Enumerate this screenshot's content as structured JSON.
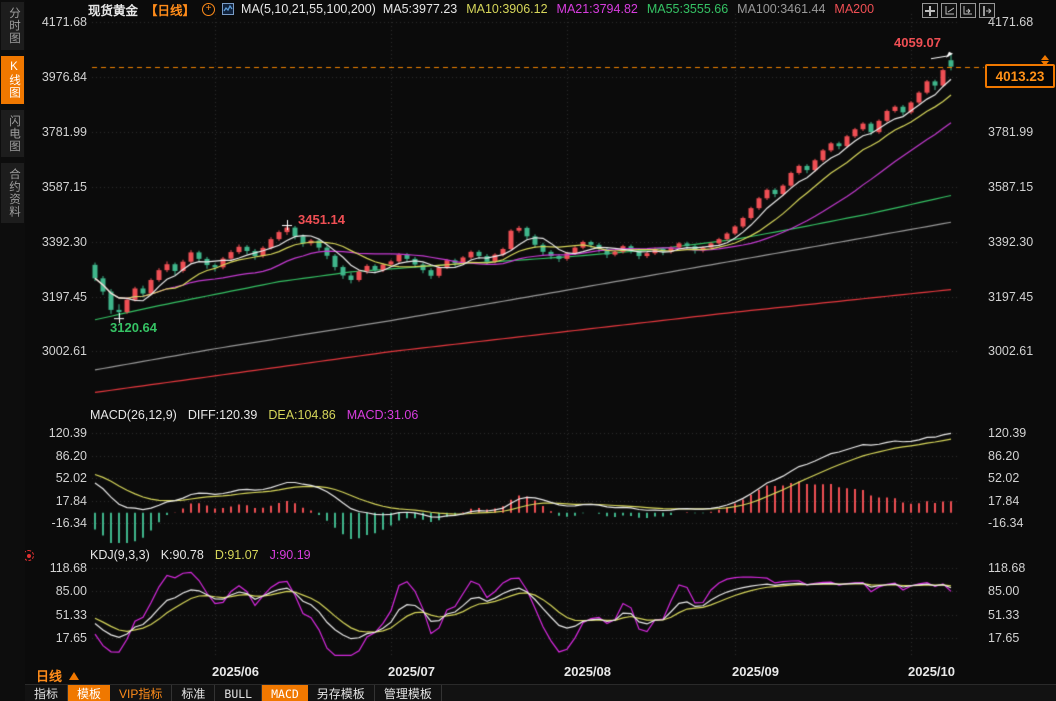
{
  "header": {
    "title": "现货黄金",
    "period": "【日线】",
    "ma_settings": "MA(5,10,21,55,100,200)",
    "ma_values": [
      {
        "label": "MA5:3977.23",
        "color": "#e6e6e6"
      },
      {
        "label": "MA10:3906.12",
        "color": "#d6d65a"
      },
      {
        "label": "MA21:3794.82",
        "color": "#d83ddf"
      },
      {
        "label": "MA55:3555.66",
        "color": "#35c264"
      },
      {
        "label": "MA100:3461.44",
        "color": "#9a9a9a"
      },
      {
        "label": "MA200",
        "color": "#ef4f54"
      }
    ]
  },
  "top_right_icons": [
    "crosshair-grid-icon",
    "scale-left-icon",
    "scale-right-icon",
    "collapse-panel-icon"
  ],
  "sidebar": {
    "tabs": [
      {
        "label": "分时图",
        "active": false
      },
      {
        "label": "K线图",
        "active": true
      },
      {
        "label": "闪电图",
        "active": false
      },
      {
        "label": "合约资料",
        "active": false
      }
    ]
  },
  "annotations": {
    "session_high": "4059.07",
    "june_high": "3451.14",
    "june_low": "3120.64"
  },
  "price_box": {
    "value": "4013.23"
  },
  "macd": {
    "title": "MACD(26,12,9)",
    "diff": "DIFF:120.39",
    "dea": "DEA:104.86",
    "macd": "MACD:31.06"
  },
  "kdj": {
    "title": "KDJ(9,3,3)",
    "k": "K:90.78",
    "d": "D:91.07",
    "j": "J:90.19"
  },
  "bottom_left": {
    "label": "日线",
    "arrow": "up-triangle"
  },
  "toolbar": {
    "items": [
      {
        "label": "指标",
        "style": "plain"
      },
      {
        "label": "模板",
        "style": "orange"
      },
      {
        "label": "VIP指标",
        "style": "vip"
      },
      {
        "label": "标准",
        "style": "plain"
      },
      {
        "label": "BULL",
        "style": "mono"
      },
      {
        "label": "MACD",
        "style": "orange mono"
      },
      {
        "label": "另存模板",
        "style": "plain"
      },
      {
        "label": "管理模板",
        "style": "plain"
      }
    ]
  },
  "chart_data": {
    "type": "candlestick",
    "title": "现货黄金 日线 (Spot Gold Daily)",
    "x0": 95,
    "dx": 8,
    "scales": {
      "main": {
        "top": 4171.68,
        "y": 22,
        "ppu": 3.549
      },
      "macd": {
        "top": 120.39,
        "y": 433.4,
        "pxu": 0.6583
      },
      "kdj": {
        "top": 118.68,
        "y": 568.2,
        "pxu": 0.6889
      }
    },
    "levels": {
      "main": [
        4171.68,
        3976.84,
        3781.99,
        3587.15,
        3392.3,
        3197.45,
        3002.61
      ],
      "macd": [
        120.39,
        86.2,
        52.02,
        17.84,
        -16.34
      ],
      "kdj": [
        118.68,
        85.0,
        51.33,
        17.65
      ]
    },
    "x_ticks": [
      15,
      37,
      59,
      80,
      102
    ],
    "x_tick_labels": [
      "2025/06",
      "2025/07",
      "2025/08",
      "2025/09",
      "2025/10"
    ],
    "last_price": 4013.23,
    "session_high": 4059.07,
    "markers": [
      {
        "idx": 3,
        "price": 3120.64
      },
      {
        "idx": 24,
        "price": 3451.14
      }
    ],
    "indicators": {
      "ma": {
        "params": [
          5,
          10,
          21,
          55,
          100,
          200
        ],
        "ma5": 3977.23,
        "ma10": 3906.12,
        "ma21": 3794.82,
        "ma55": 3555.66,
        "ma100": 3461.44
      },
      "macd": {
        "params": "26,12,9",
        "diff": 120.39,
        "dea": 104.86,
        "macd": 31.06
      },
      "kdj": {
        "params": "9,3,3",
        "k": 90.78,
        "d": 91.07,
        "j": 90.19
      }
    },
    "candles": [
      [
        3310,
        3318,
        3252,
        3262
      ],
      [
        3262,
        3270,
        3203,
        3215
      ],
      [
        3215,
        3224,
        3136,
        3150
      ],
      [
        3150,
        3170,
        3120.64,
        3142
      ],
      [
        3142,
        3194,
        3136,
        3186
      ],
      [
        3186,
        3232,
        3180,
        3226
      ],
      [
        3226,
        3236,
        3194,
        3208
      ],
      [
        3208,
        3262,
        3202,
        3256
      ],
      [
        3256,
        3298,
        3250,
        3291
      ],
      [
        3291,
        3322,
        3284,
        3312
      ],
      [
        3312,
        3318,
        3274,
        3288
      ],
      [
        3288,
        3328,
        3282,
        3321
      ],
      [
        3321,
        3362,
        3315,
        3354
      ],
      [
        3354,
        3360,
        3320,
        3331
      ],
      [
        3331,
        3338,
        3296,
        3309
      ],
      [
        3309,
        3315,
        3286,
        3301
      ],
      [
        3301,
        3338,
        3294,
        3332
      ],
      [
        3332,
        3362,
        3326,
        3355
      ],
      [
        3355,
        3382,
        3348,
        3374
      ],
      [
        3374,
        3380,
        3348,
        3359
      ],
      [
        3359,
        3366,
        3328,
        3341
      ],
      [
        3341,
        3376,
        3335,
        3370
      ],
      [
        3370,
        3408,
        3364,
        3401
      ],
      [
        3401,
        3432,
        3395,
        3426
      ],
      [
        3426,
        3451.14,
        3416,
        3442
      ],
      [
        3442,
        3448,
        3400,
        3411
      ],
      [
        3411,
        3418,
        3374,
        3386
      ],
      [
        3386,
        3402,
        3378,
        3396
      ],
      [
        3396,
        3401,
        3360,
        3371
      ],
      [
        3371,
        3378,
        3330,
        3342
      ],
      [
        3342,
        3348,
        3290,
        3302
      ],
      [
        3302,
        3308,
        3260,
        3272
      ],
      [
        3272,
        3282,
        3244,
        3256
      ],
      [
        3256,
        3292,
        3250,
        3286
      ],
      [
        3286,
        3312,
        3278,
        3306
      ],
      [
        3306,
        3312,
        3280,
        3291
      ],
      [
        3291,
        3316,
        3284,
        3311
      ],
      [
        3311,
        3328,
        3304,
        3322
      ],
      [
        3322,
        3352,
        3315,
        3346
      ],
      [
        3346,
        3352,
        3320,
        3331
      ],
      [
        3331,
        3338,
        3300,
        3311
      ],
      [
        3311,
        3318,
        3280,
        3291
      ],
      [
        3291,
        3298,
        3260,
        3271
      ],
      [
        3271,
        3306,
        3264,
        3301
      ],
      [
        3301,
        3331,
        3295,
        3326
      ],
      [
        3326,
        3332,
        3304,
        3316
      ],
      [
        3316,
        3341,
        3310,
        3336
      ],
      [
        3336,
        3361,
        3330,
        3356
      ],
      [
        3356,
        3362,
        3330,
        3341
      ],
      [
        3341,
        3348,
        3310,
        3321
      ],
      [
        3321,
        3351,
        3315,
        3346
      ],
      [
        3346,
        3371,
        3340,
        3366
      ],
      [
        3366,
        3436,
        3360,
        3431
      ],
      [
        3431,
        3448,
        3424,
        3441
      ],
      [
        3441,
        3446,
        3400,
        3411
      ],
      [
        3411,
        3418,
        3370,
        3381
      ],
      [
        3381,
        3388,
        3344,
        3356
      ],
      [
        3356,
        3362,
        3330,
        3341
      ],
      [
        3341,
        3348,
        3320,
        3331
      ],
      [
        3331,
        3356,
        3324,
        3351
      ],
      [
        3351,
        3376,
        3345,
        3371
      ],
      [
        3371,
        3396,
        3365,
        3391
      ],
      [
        3391,
        3396,
        3370,
        3381
      ],
      [
        3381,
        3388,
        3354,
        3366
      ],
      [
        3366,
        3372,
        3334,
        3346
      ],
      [
        3346,
        3361,
        3340,
        3356
      ],
      [
        3356,
        3381,
        3350,
        3376
      ],
      [
        3376,
        3382,
        3350,
        3361
      ],
      [
        3361,
        3368,
        3330,
        3341
      ],
      [
        3341,
        3356,
        3334,
        3351
      ],
      [
        3351,
        3371,
        3345,
        3366
      ],
      [
        3366,
        3372,
        3344,
        3356
      ],
      [
        3356,
        3376,
        3350,
        3371
      ],
      [
        3371,
        3391,
        3365,
        3386
      ],
      [
        3386,
        3392,
        3364,
        3376
      ],
      [
        3376,
        3382,
        3350,
        3361
      ],
      [
        3361,
        3376,
        3354,
        3371
      ],
      [
        3371,
        3391,
        3365,
        3386
      ],
      [
        3386,
        3406,
        3380,
        3401
      ],
      [
        3401,
        3426,
        3395,
        3421
      ],
      [
        3421,
        3451,
        3415,
        3446
      ],
      [
        3446,
        3481,
        3440,
        3476
      ],
      [
        3476,
        3516,
        3470,
        3511
      ],
      [
        3511,
        3551,
        3505,
        3546
      ],
      [
        3546,
        3581,
        3540,
        3576
      ],
      [
        3576,
        3582,
        3550,
        3561
      ],
      [
        3561,
        3596,
        3554,
        3591
      ],
      [
        3591,
        3641,
        3585,
        3636
      ],
      [
        3636,
        3666,
        3630,
        3661
      ],
      [
        3661,
        3667,
        3635,
        3646
      ],
      [
        3646,
        3686,
        3640,
        3681
      ],
      [
        3681,
        3721,
        3675,
        3716
      ],
      [
        3716,
        3746,
        3710,
        3741
      ],
      [
        3741,
        3747,
        3720,
        3731
      ],
      [
        3731,
        3771,
        3725,
        3766
      ],
      [
        3766,
        3796,
        3760,
        3791
      ],
      [
        3791,
        3816,
        3785,
        3811
      ],
      [
        3811,
        3817,
        3770,
        3781
      ],
      [
        3781,
        3826,
        3775,
        3821
      ],
      [
        3821,
        3861,
        3815,
        3856
      ],
      [
        3856,
        3876,
        3850,
        3871
      ],
      [
        3871,
        3877,
        3840,
        3851
      ],
      [
        3851,
        3891,
        3845,
        3886
      ],
      [
        3886,
        3926,
        3880,
        3921
      ],
      [
        3921,
        3966,
        3915,
        3961
      ],
      [
        3961,
        3967,
        3930,
        3946
      ],
      [
        3946,
        4006,
        3940,
        4001
      ],
      [
        4036,
        4059.07,
        4000,
        4013.23
      ]
    ],
    "ma_overlays": {
      "ma55": [
        [
          0,
          3115
        ],
        [
          8,
          3165
        ],
        [
          15,
          3205
        ],
        [
          23,
          3250
        ],
        [
          32,
          3285
        ],
        [
          44,
          3310
        ],
        [
          59,
          3338
        ],
        [
          69,
          3362
        ],
        [
          80,
          3400
        ],
        [
          88,
          3442
        ],
        [
          97,
          3492
        ],
        [
          107,
          3556
        ]
      ],
      "ma100": [
        [
          0,
          2937
        ],
        [
          15,
          3012
        ],
        [
          37,
          3112
        ],
        [
          59,
          3220
        ],
        [
          80,
          3325
        ],
        [
          94,
          3395
        ],
        [
          107,
          3461
        ]
      ],
      "ma200": [
        [
          0,
          2857
        ],
        [
          37,
          3002
        ],
        [
          80,
          3142
        ],
        [
          107,
          3222
        ]
      ]
    },
    "colors": {
      "up": "#ef4f54",
      "down": "#3fb68b",
      "ma5": "#e9e9e9",
      "ma10": "#d6d65a",
      "ma21": "#c43ad1",
      "ma55": "#35c264",
      "ma100": "#9a9a9a",
      "ma200": "#e8393f",
      "j": "#d829e0",
      "grid": "#2d2d2d",
      "accent": "#f08200",
      "bg": "#0b0b0b"
    }
  }
}
